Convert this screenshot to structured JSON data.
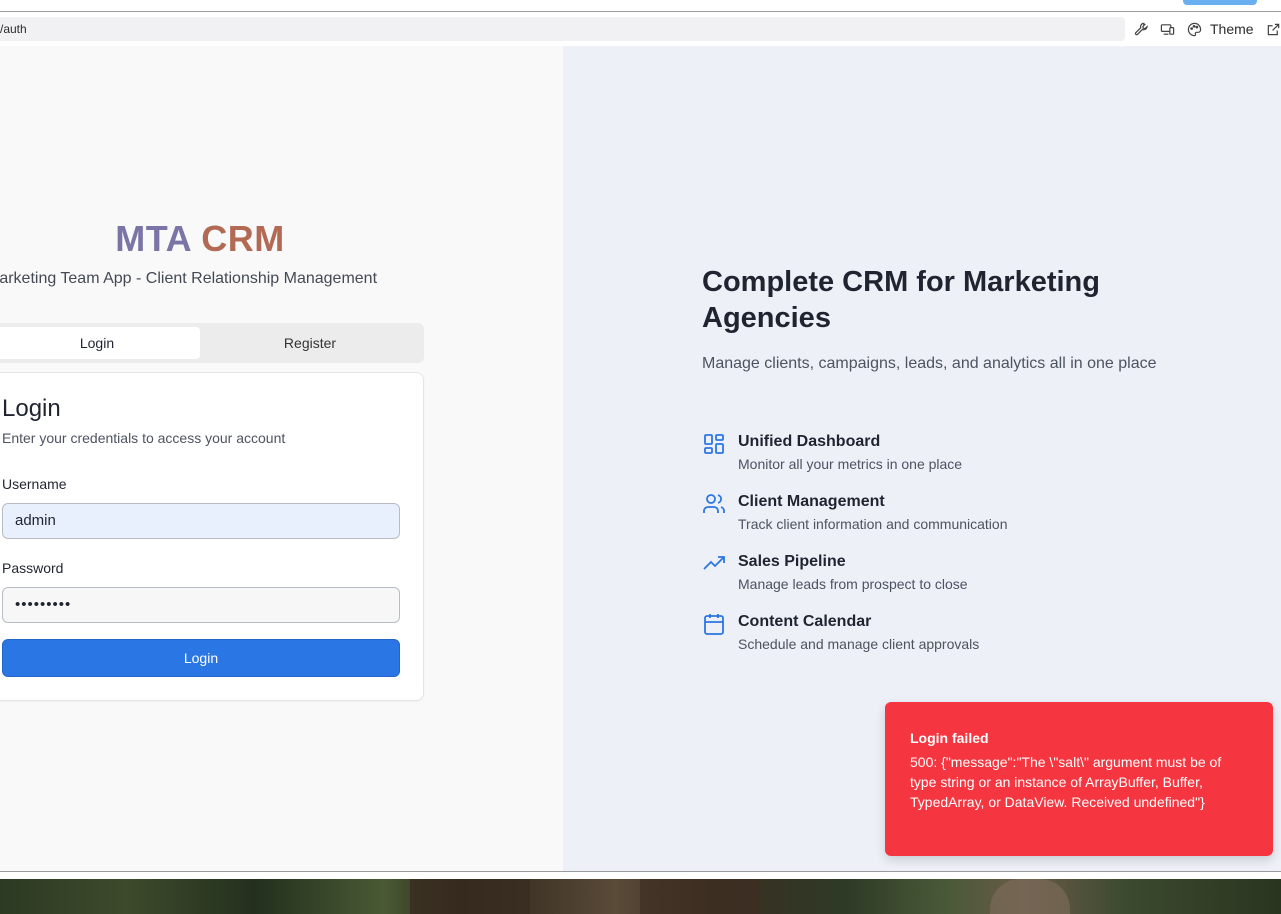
{
  "browser": {
    "url": "/auth",
    "theme_label": "Theme",
    "icons": [
      "wrench-icon",
      "devices-icon",
      "palette-icon",
      "external-link-icon"
    ]
  },
  "brand": {
    "part1": "MTA",
    "part2": "CRM",
    "subtitle": "Marketing Team App - Client Relationship Management",
    "colors": {
      "part1": "#7a75a6",
      "part2": "#b26a55"
    }
  },
  "tabs": [
    {
      "label": "Login",
      "active": true
    },
    {
      "label": "Register",
      "active": false
    }
  ],
  "login_card": {
    "title": "Login",
    "description": "Enter your credentials to access your account",
    "username_label": "Username",
    "username_value": "admin",
    "password_label": "Password",
    "password_value": "•••••••••",
    "submit_label": "Login"
  },
  "hero": {
    "title": "Complete CRM for Marketing Agencies",
    "subtitle": "Manage clients, campaigns, leads, and analytics all in one place"
  },
  "features": [
    {
      "icon": "dashboard-icon",
      "title": "Unified Dashboard",
      "description": "Monitor all your metrics in one place"
    },
    {
      "icon": "users-icon",
      "title": "Client Management",
      "description": "Track client information and communication"
    },
    {
      "icon": "trending-up-icon",
      "title": "Sales Pipeline",
      "description": "Manage leads from prospect to close"
    },
    {
      "icon": "calendar-icon",
      "title": "Content Calendar",
      "description": "Schedule and manage client approvals"
    }
  ],
  "toast": {
    "title": "Login failed",
    "message": "500: {\"message\":\"The \\\"salt\\\" argument must be of type string or an instance of ArrayBuffer, Buffer, TypedArray, or DataView. Received undefined\"}",
    "color": "#f5353f"
  },
  "colors": {
    "accent": "#2b76e5",
    "icon_blue": "#2b76e5"
  }
}
